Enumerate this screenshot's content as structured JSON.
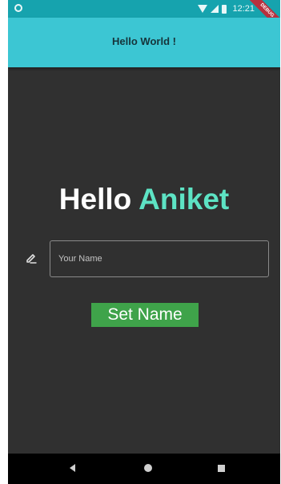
{
  "status_bar": {
    "time": "12:21",
    "debug_label": "DEBUG"
  },
  "app_bar": {
    "title": "Hello World !"
  },
  "greeting": {
    "word": "Hello",
    "name": "Aniket"
  },
  "name_input": {
    "placeholder": "Your Name",
    "value": ""
  },
  "set_name_button": {
    "label": "Set Name"
  },
  "colors": {
    "status_bar": "#16a3ae",
    "app_bar": "#3cc6d3",
    "background": "#303030",
    "accent_name": "#5de3c4",
    "button": "#3fa34a"
  },
  "icons": {
    "field_prefix": "edit-icon",
    "nav": [
      "back-icon",
      "home-icon",
      "recents-icon"
    ]
  }
}
